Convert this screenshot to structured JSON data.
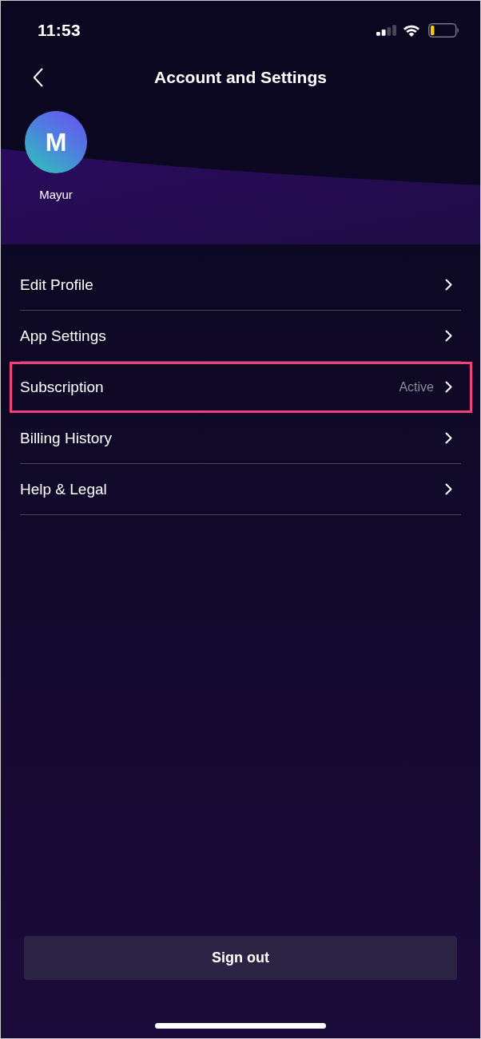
{
  "status_bar": {
    "time": "11:53"
  },
  "header": {
    "title": "Account and Settings"
  },
  "profile": {
    "initial": "M",
    "name": "Mayur"
  },
  "menu": {
    "items": [
      {
        "label": "Edit Profile",
        "highlighted": false
      },
      {
        "label": "App Settings",
        "highlighted": false
      },
      {
        "label": "Subscription",
        "value": "Active",
        "highlighted": true
      },
      {
        "label": "Billing History",
        "highlighted": false
      },
      {
        "label": "Help & Legal",
        "highlighted": false
      }
    ]
  },
  "sign_out": {
    "label": "Sign out"
  }
}
